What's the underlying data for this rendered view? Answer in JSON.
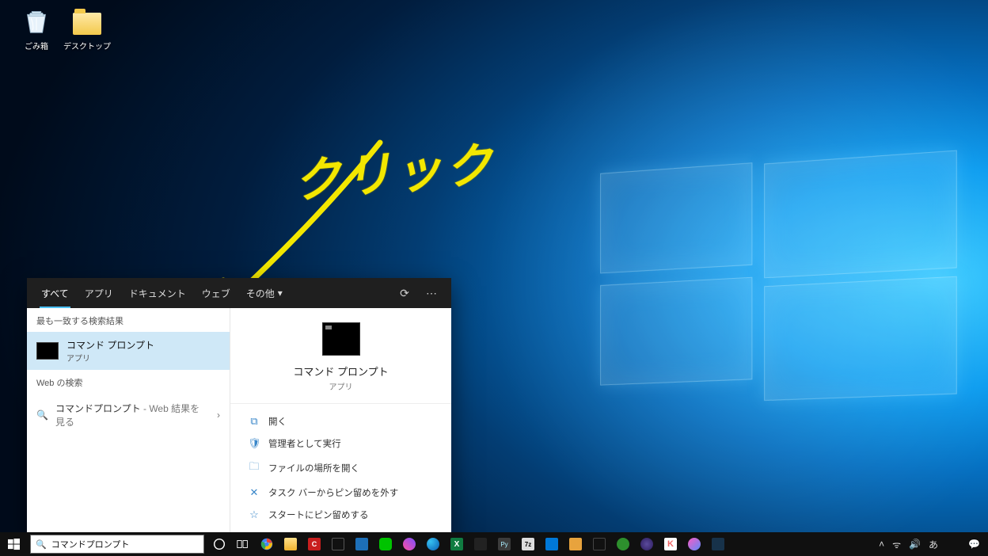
{
  "desktop": {
    "icons": [
      {
        "name": "recycle-bin",
        "label": "ごみ箱"
      },
      {
        "name": "desktop-folder",
        "label": "デスクトップ"
      }
    ]
  },
  "annotation": {
    "text": "クリック"
  },
  "search_panel": {
    "tabs": [
      "すべて",
      "アプリ",
      "ドキュメント",
      "ウェブ",
      "その他"
    ],
    "active_tab_index": 0,
    "best_match_header": "最も一致する検索結果",
    "best_match": {
      "title": "コマンド プロンプト",
      "subtitle": "アプリ"
    },
    "web_header": "Web の検索",
    "web_row": {
      "query": "コマンドプロンプト",
      "suffix": " - Web 結果を見る"
    },
    "right": {
      "title": "コマンド プロンプト",
      "subtitle": "アプリ",
      "actions": [
        {
          "icon": "open",
          "label": "開く"
        },
        {
          "icon": "admin",
          "label": "管理者として実行"
        },
        {
          "icon": "location",
          "label": "ファイルの場所を開く"
        },
        {
          "icon": "unpin",
          "label": "タスク バーからピン留めを外す"
        },
        {
          "icon": "pin-start",
          "label": "スタートにピン留めする"
        }
      ]
    }
  },
  "taskbar": {
    "search_value": "コマンドプロンプト",
    "apps": [
      "cortana",
      "task-view",
      "chrome",
      "explorer",
      "cubase",
      "terminal1",
      "vm",
      "line",
      "paint3d",
      "edge",
      "excel",
      "krita",
      "pycharm",
      "7zip",
      "vscode",
      "app1",
      "term2",
      "spotify",
      "eclipse",
      "k",
      "itunes",
      "app2"
    ],
    "tray": {
      "chevron": "˄",
      "net": "ᯤ",
      "vol": "🔊",
      "ime": "あ"
    }
  }
}
